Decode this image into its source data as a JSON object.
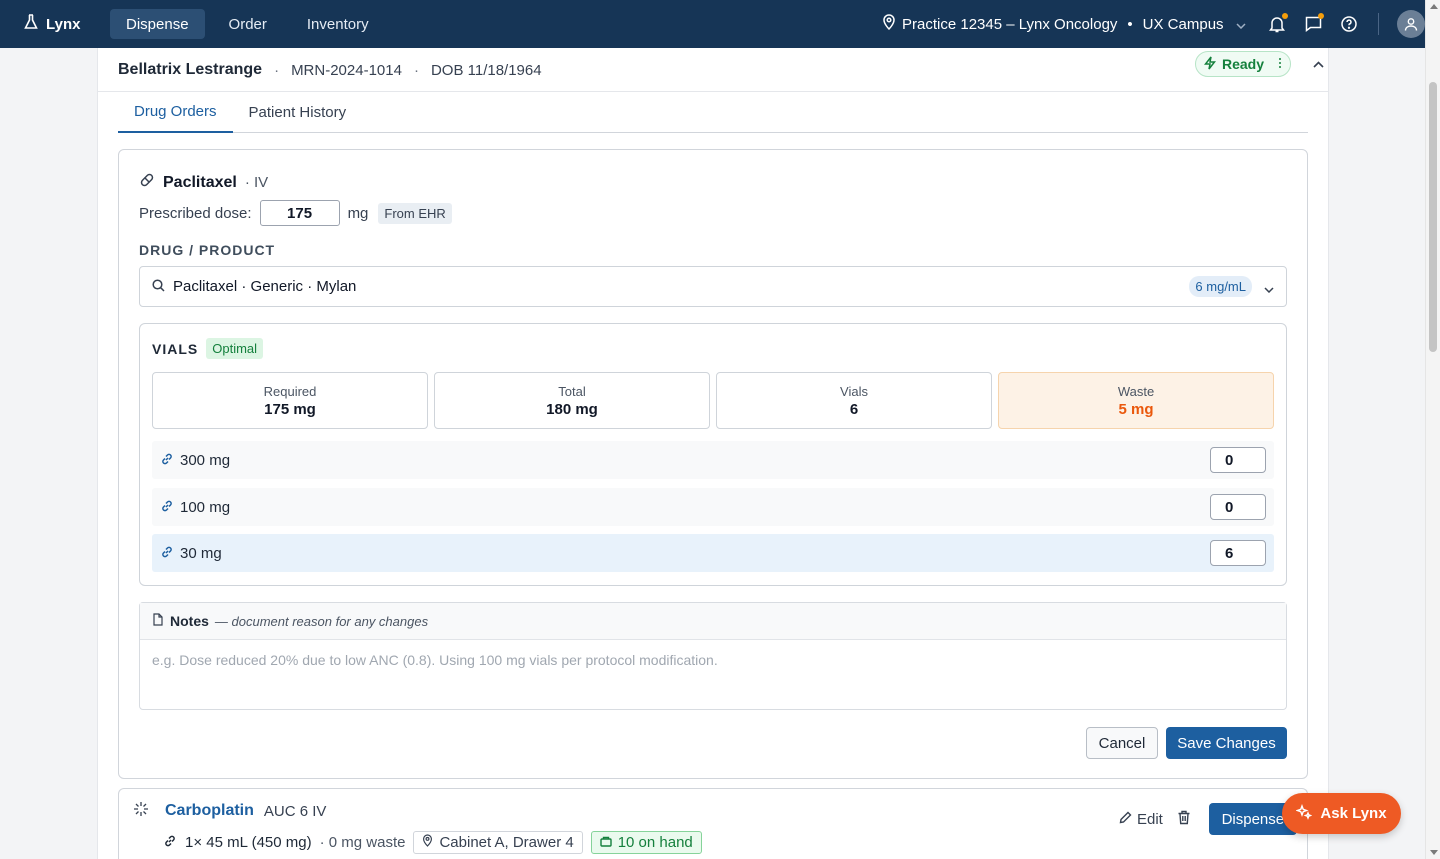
{
  "nav": {
    "brand": "Lynx",
    "items": [
      {
        "label": "Dispense",
        "active": true
      },
      {
        "label": "Order",
        "active": false
      },
      {
        "label": "Inventory",
        "active": false
      }
    ],
    "practice": "Practice 12345 – Lynx Oncology",
    "campus": "UX Campus",
    "bullet": "•"
  },
  "patient": {
    "name": "Bellatrix Lestrange",
    "separator": "·",
    "mrn": "MRN-2024-1014",
    "dob": "DOB 11/18/1964",
    "status": "Ready"
  },
  "tabs": [
    {
      "label": "Drug Orders",
      "active": true
    },
    {
      "label": "Patient History",
      "active": false
    }
  ],
  "order": {
    "drug": "Paclitaxel",
    "route": "· IV",
    "dose_label": "Prescribed dose:",
    "dose_value": "175",
    "dose_unit": "mg",
    "dose_source": "From EHR",
    "product_label": "DRUG / PRODUCT",
    "product": "Paclitaxel · Generic · Mylan",
    "concentration": "6 mg/mL",
    "vials": {
      "title": "VIALS",
      "status": "Optimal",
      "stats": [
        {
          "label": "Required",
          "value": "175 mg"
        },
        {
          "label": "Total",
          "value": "180 mg"
        },
        {
          "label": "Vials",
          "value": "6"
        },
        {
          "label": "Waste",
          "value": "5 mg"
        }
      ],
      "rows": [
        {
          "size": "300 mg",
          "qty": "0",
          "selected": false
        },
        {
          "size": "100 mg",
          "qty": "0",
          "selected": false
        },
        {
          "size": "30 mg",
          "qty": "6",
          "selected": true
        }
      ]
    },
    "notes": {
      "title": "Notes",
      "hint": "— document reason for any changes",
      "placeholder": "e.g. Dose reduced 20% due to low ANC (0.8). Using 100 mg vials per protocol modification."
    },
    "cancel_label": "Cancel",
    "save_label": "Save Changes"
  },
  "order2": {
    "drug": "Carboplatin",
    "regimen": "AUC 6 IV",
    "vials": "1× 45 mL (450 mg)",
    "waste": "· 0 mg waste",
    "location": "Cabinet A, Drawer 4",
    "stock": "10 on hand",
    "edit_label": "Edit",
    "dispense_label": "Dispense"
  },
  "assistant": {
    "label": "Ask Lynx"
  },
  "colors": {
    "nav_bg": "#163556",
    "accent": "#1d5fa0",
    "ready": "#15803d",
    "waste": "#ea580c",
    "assistant": "#ee5a24"
  }
}
